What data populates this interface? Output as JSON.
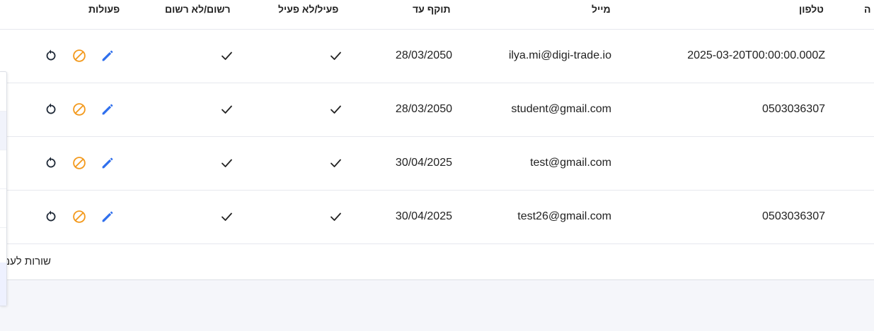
{
  "columns": {
    "partial_first": "ה",
    "phone": "טלפון",
    "email": "מייל",
    "valid_until": "תוקף עד",
    "active": "פעיל/לא פעיל",
    "registered": "רשום/לא רשום",
    "actions": "פעולות"
  },
  "rows": [
    {
      "phone": "2025-03-20T00:00:00.000Z",
      "email": "ilya.mi@digi-trade.io",
      "valid_until": "28/03/2050",
      "active": true,
      "registered": true
    },
    {
      "phone": "0503036307",
      "email": "student@gmail.com",
      "valid_until": "28/03/2050",
      "active": true,
      "registered": true
    },
    {
      "phone": "",
      "email": "test@gmail.com",
      "valid_until": "30/04/2025",
      "active": true,
      "registered": true
    },
    {
      "phone": "0503036307",
      "email": "test26@gmail.com",
      "valid_until": "30/04/2025",
      "active": true,
      "registered": true
    }
  ],
  "footer": {
    "rows_per_page_label": "שורות לעמוד"
  },
  "icons": {
    "check": "check-icon",
    "edit": "pencil-icon",
    "block": "block-icon",
    "reset": "refresh-icon"
  },
  "colors": {
    "edit": "#2f6fed",
    "block": "#f39a1e",
    "reset": "#1f2937"
  }
}
